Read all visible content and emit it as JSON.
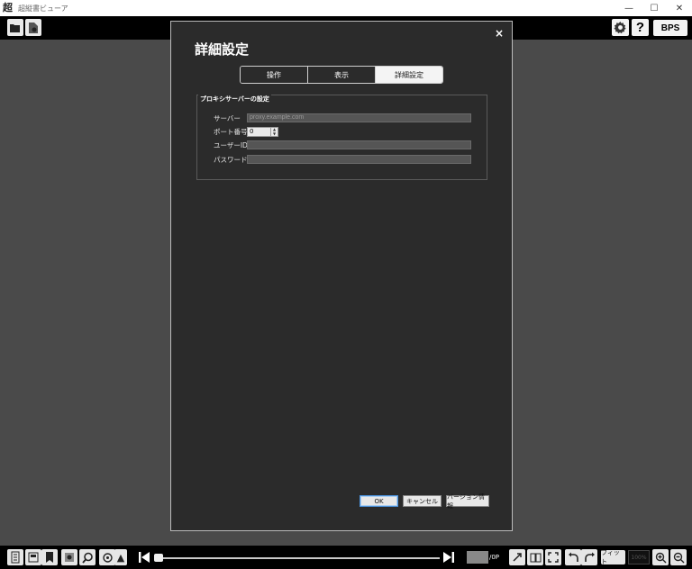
{
  "window": {
    "app_icon": "超",
    "title": "超縦書ビューア",
    "minimize": "—",
    "maximize": "☐",
    "close": "✕"
  },
  "top_toolbar": {
    "help_label": "?",
    "bps_label": "BPS"
  },
  "dialog": {
    "title": "詳細設定",
    "close_label": "×",
    "tabs": [
      {
        "label": "操作",
        "active": false
      },
      {
        "label": "表示",
        "active": false
      },
      {
        "label": "詳細設定",
        "active": true
      }
    ],
    "proxy_group": {
      "title": "プロキシサーバーの設定",
      "server_label": "サーバー",
      "server_placeholder": "proxy.example.com",
      "port_label": "ポート番号",
      "port_value": "0",
      "user_label": "ユーザーID",
      "user_value": "",
      "password_label": "パスワード",
      "password_value": ""
    },
    "buttons": {
      "ok": "OK",
      "cancel": "キャンセル",
      "version": "バージョン情報"
    }
  },
  "bottom_toolbar": {
    "page_total": "/0P",
    "fit_label": "フィット",
    "zoom_value": "100%"
  },
  "colors": {
    "background": "#4a4a4a",
    "dialog_bg": "#2b2b2b",
    "toolbar_bg": "#000000",
    "active_tab_bg": "#f4f4f4"
  }
}
